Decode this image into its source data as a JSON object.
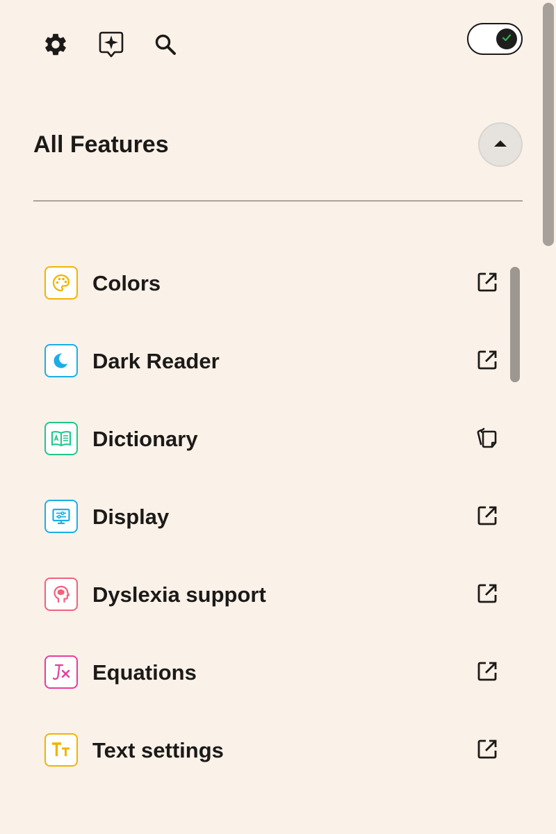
{
  "toolbar": {
    "icons": [
      "gear-icon",
      "assistant-sparkle-icon",
      "search-icon"
    ],
    "toggle_state": "on"
  },
  "header": {
    "title": "All Features",
    "collapse_icon": "caret-up-icon"
  },
  "features": [
    {
      "label": "Colors",
      "icon": "palette-icon",
      "color": "#f0b400",
      "action_icon": "open-external-icon"
    },
    {
      "label": "Dark Reader",
      "icon": "moon-icon",
      "color": "#1aaee6",
      "action_icon": "open-external-icon"
    },
    {
      "label": "Dictionary",
      "icon": "dictionary-book-icon",
      "color": "#1ec88a",
      "action_icon": "copy-icon"
    },
    {
      "label": "Display",
      "icon": "display-monitor-icon",
      "color": "#1aaee6",
      "action_icon": "open-external-icon"
    },
    {
      "label": "Dyslexia support",
      "icon": "brain-head-icon",
      "color": "#f2607a",
      "action_icon": "open-external-icon"
    },
    {
      "label": "Equations",
      "icon": "equation-icon",
      "color": "#e63c9a",
      "action_icon": "open-external-icon"
    },
    {
      "label": "Text settings",
      "icon": "text-size-icon",
      "color": "#f0b400",
      "action_icon": "open-external-icon"
    }
  ],
  "colors": {
    "background": "#faf1e8",
    "text": "#1c1a18",
    "toggle_check": "#2fb34a"
  }
}
